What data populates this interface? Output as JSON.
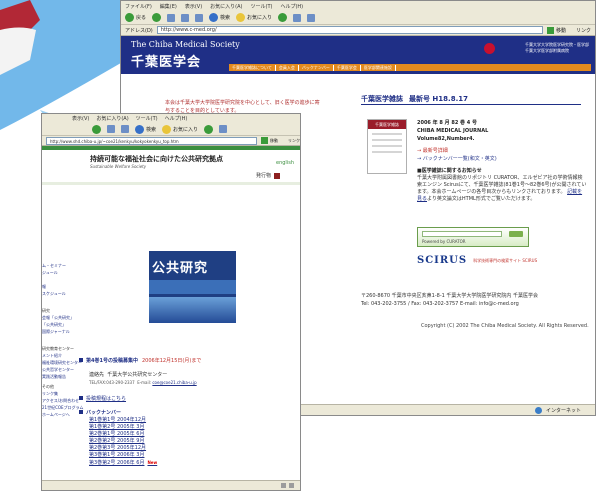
{
  "colors": {
    "bg_blue": "#72b8ea",
    "header_navy": "#1f2f86",
    "accent_orange": "#e38a1e",
    "link_red": "#c0312b"
  },
  "back_window": {
    "menu": [
      "ファイル(F)",
      "編集(E)",
      "表示(V)",
      "お気に入り(A)",
      "ツール(T)",
      "ヘルプ(H)"
    ],
    "toolbar": {
      "back": "戻る",
      "search": "検索",
      "favorites": "お気に入り"
    },
    "address_label": "アドレス(D)",
    "address_value": "http://www.c-med.org/",
    "go_label": "移動",
    "links_label": "リンク",
    "header_en": "The Chiba Medical Society",
    "header_ja": "千葉医学会",
    "header_uni": "千葉大学大学院医学研究院・医学部\n千葉大学医学部附属病院",
    "nav": [
      "千葉医学雑誌について",
      "会員入会",
      "バックナンバー",
      "千葉医学会",
      "医学部関連施設"
    ],
    "notice": "本会は千葉大学大学院医学研究院を中心として、旧く医学の進歩に寄与することを目的としています。",
    "journal_heading": "千葉医学雑誌",
    "journal_latest": "最新号 H18.8.17",
    "cover_label": "千葉医学雑誌",
    "issue_lines": [
      "2006 年 8 月 82 巻 4 号",
      "CHIBA MEDICAL JOURNAL",
      "Volume82,Number4."
    ],
    "link_latest": "→ 最新号詳細",
    "link_backnumber": "→ バックナンバー一覧(和文・英文)",
    "notice_heading": "■医学雑誌に関するお知らせ",
    "notice_body": "千葉大学附属図書館のリポジトリ CURATOR、エルゼビア社の学術情報検索エンジン Scirusにて、千葉医学雑誌(81巻1号～82巻6号)が公開されています。本会ホームページの各号目次からもリンクされております。",
    "notice_link": "記載を見る",
    "notice_tail": "より英文論文はHTML形式でご覧いただけます。",
    "curator_label": "Powered by CURATOR",
    "scirus_logo": "SCIRUS",
    "scirus_desc": "科学技術専門の検索サイト SCIRUS",
    "address_footer": "〒260-8670 千葉市中央区亥鼻1-8-1 千葉大学大学院医学研究院内 千葉医学会",
    "tel_footer": "Tel: 043-202-3755 / Fax: 043-202-3757 E-mail: info@c-med.org",
    "copyright": "Copyright (C) 2002 The Chiba Medical Society. All Rights Reserved.",
    "status": "インターネット"
  },
  "front_window": {
    "menu": [
      "表示(V)",
      "お気に入り(A)",
      "ツール(T)",
      "ヘルプ(H)"
    ],
    "toolbar": {
      "search": "検索",
      "favorites": "お気に入り"
    },
    "address_value": "http://www.shd.chiba-u.jp/~coe21/kenkyu/kokyokenkyu_top.htm",
    "go_label": "移動",
    "links_label": "リンク",
    "header_ja": "持続可能な福祉社会に向けた公共研究拠点",
    "header_en": "Sustainable Welfare Society",
    "english_link": "english",
    "hakko": "発行物",
    "side_items": [
      "ム・セミナー",
      "ジュール",
      "",
      "報",
      "スケジュール",
      "",
      "研究",
      "会報「公共研究」",
      "「公共研究」",
      "国際ジャーナル",
      "",
      "研究教育センター",
      "メント紹介",
      "福祉環境研究センター",
      "公共哲学センター",
      "実践活動報告",
      "その他",
      "リンク集",
      "アクセス/お問合わせ",
      "21世紀COEプログラム",
      "ホームページへ"
    ],
    "banner_title": "公共研究",
    "news_heading": "第4巻1号の投稿募集中",
    "news_date": "2006年12月15日(月)まで",
    "contact_label": "連絡先",
    "contact_value": "千葉大学公共研究センター",
    "tel": "TEL/FAX:043-290-2337",
    "email_label": "E-mail",
    "email": "coe@coe21.chiba-u.jp",
    "submission": "投稿規程はこちら",
    "backnumber_heading": "バックナンバー",
    "backnumbers": [
      "第1巻第1号 2004年12月",
      "第1巻第2号 2005年 3月",
      "第2巻第1号 2005年 6月",
      "第2巻第2号 2005年 9月",
      "第2巻第3号 2005年12月",
      "第3巻第1号 2006年 3月",
      "第3巻第2号 2006年 6月"
    ],
    "new_badge": "New"
  }
}
